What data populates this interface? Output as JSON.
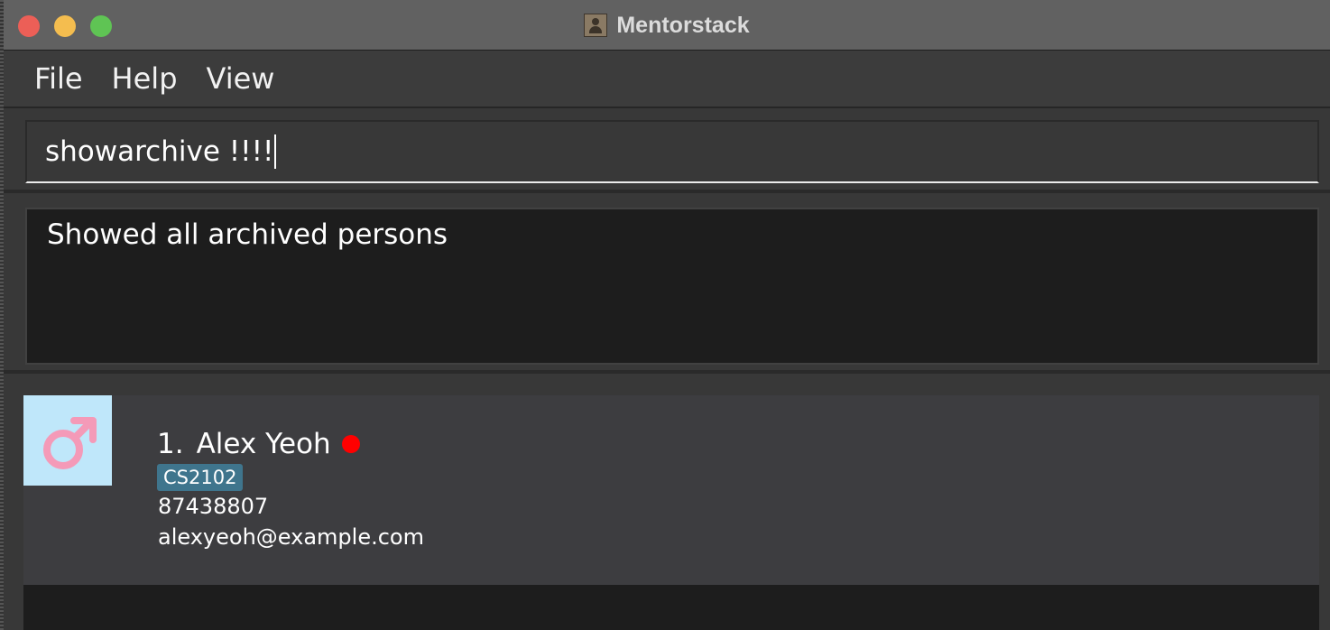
{
  "window": {
    "title": "Mentorstack",
    "app_icon": "contacts-book-icon"
  },
  "menu": {
    "items": [
      {
        "label": "File"
      },
      {
        "label": "Help"
      },
      {
        "label": "View"
      }
    ]
  },
  "command_box": {
    "value": "showarchive !!!!"
  },
  "result_display": {
    "text": "Showed all archived persons"
  },
  "person_list": [
    {
      "index": "1.",
      "name": "Alex Yeoh",
      "status_color": "#ff0000",
      "avatar_icon": "male-symbol-icon",
      "avatar_bg": "#bfe7fa",
      "avatar_symbol_color": "#f49ab8",
      "tags": [
        "CS2102"
      ],
      "phone": "87438807",
      "email": "alexyeoh@example.com"
    }
  ],
  "colors": {
    "titlebar": "#616161",
    "background": "#383838",
    "result_bg": "#1d1d1d",
    "card_bg": "#3d3d40",
    "tag_bg": "#3f758d",
    "close": "#ec5f57",
    "minimize": "#f4bd4f",
    "maximize": "#5fc454"
  }
}
